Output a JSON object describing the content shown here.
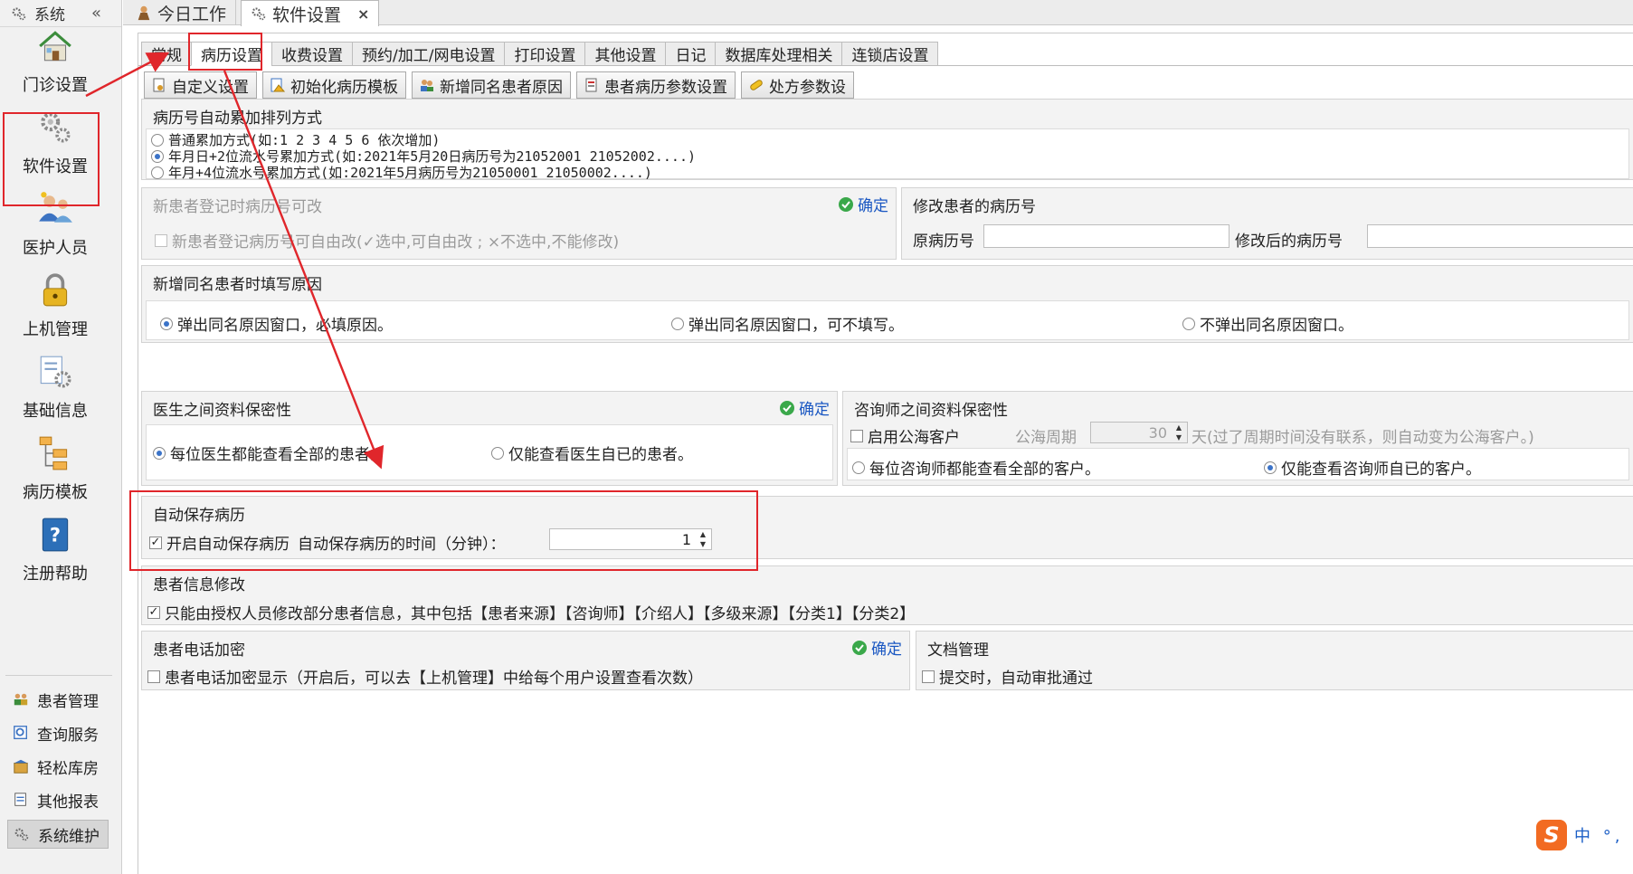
{
  "sidebar": {
    "header": "系统",
    "collapse": "«",
    "big_items": [
      {
        "label": "门诊设置",
        "icon": "home-icon"
      },
      {
        "label": "软件设置",
        "icon": "gears-icon"
      },
      {
        "label": "医护人员",
        "icon": "staff-icon"
      },
      {
        "label": "上机管理",
        "icon": "lock-icon"
      },
      {
        "label": "基础信息",
        "icon": "info-gear-icon"
      },
      {
        "label": "病历模板",
        "icon": "tree-icon"
      },
      {
        "label": "注册帮助",
        "icon": "help-book-icon"
      }
    ],
    "small_items": [
      {
        "label": "患者管理",
        "icon": "patients-icon"
      },
      {
        "label": "查询服务",
        "icon": "query-icon"
      },
      {
        "label": "轻松库房",
        "icon": "warehouse-icon"
      },
      {
        "label": "其他报表",
        "icon": "report-icon"
      },
      {
        "label": "系统维护",
        "icon": "gear-icon"
      }
    ]
  },
  "doc_tabs": [
    {
      "label": "今日工作",
      "icon": "work-icon"
    },
    {
      "label": "软件设置",
      "icon": "gear-icon",
      "close": "×"
    }
  ],
  "subtabs": [
    "常规",
    "病历设置",
    "收费设置",
    "预约/加工/网电设置",
    "打印设置",
    "其他设置",
    "日记",
    "数据库处理相关",
    "连锁店设置"
  ],
  "toolbar": [
    "自定义设置",
    "初始化病历模板",
    "新增同名患者原因",
    "患者病历参数设置",
    "处方参数设"
  ],
  "record_order": {
    "title": "病历号自动累加排列方式",
    "options": [
      "普通累加方式(如:1  2  3  4  5  6 依次增加)",
      "年月日+2位流水号累加方式(如:2021年5月20日病历号为21052001 21052002....)",
      "年月+4位流水号累加方式(如:2021年5月病历号为21050001 21050002....)"
    ]
  },
  "new_patient_edit": {
    "title": "新患者登记时病历号可改",
    "confirm": "确定",
    "checkbox": "新患者登记病历号可自由改(✓选中,可自由改 ; ×不选中,不能修改)"
  },
  "modify_record": {
    "title": "修改患者的病历号",
    "original_label": "原病历号",
    "new_label": "修改后的病历号"
  },
  "same_name": {
    "title": "新增同名患者时填写原因",
    "options": [
      "弹出同名原因窗口，必填原因。",
      "弹出同名原因窗口，可不填写。",
      "不弹出同名原因窗口。"
    ]
  },
  "doctor_privacy": {
    "title": "医生之间资料保密性",
    "confirm": "确定",
    "options": [
      "每位医生都能查看全部的患者。",
      "仅能查看医生自已的患者。"
    ]
  },
  "consultant_privacy": {
    "title": "咨询师之间资料保密性",
    "public_checkbox": "启用公海客户",
    "cycle_label": "公海周期",
    "cycle_value": "30",
    "cycle_suffix": "天(过了周期时间没有联系，则自动变为公海客户。)",
    "options": [
      "每位咨询师都能查看全部的客户。",
      "仅能查看咨询师自已的客户。"
    ]
  },
  "auto_save": {
    "title": "自动保存病历",
    "checkbox": "开启自动保存病历",
    "time_label": "自动保存病历的时间（分钟）：",
    "time_value": "1"
  },
  "patient_edit": {
    "title": "患者信息修改",
    "checkbox": "只能由授权人员修改部分患者信息，其中包括【患者来源】【咨询师】【介绍人】【多级来源】【分类1】【分类2】"
  },
  "phone_encrypt": {
    "title": "患者电话加密",
    "confirm": "确定",
    "checkbox": "患者电话加密显示（开启后，可以去【上机管理】中给每个用户设置查看次数）"
  },
  "doc_manage": {
    "title": "文档管理",
    "checkbox": "提交时，自动审批通过"
  },
  "ime": {
    "logo": "S",
    "text": "中 °,"
  },
  "colors": {
    "accent_red": "#e0262b",
    "link_blue": "#1a57c2",
    "confirm_green": "#3aa84a"
  }
}
